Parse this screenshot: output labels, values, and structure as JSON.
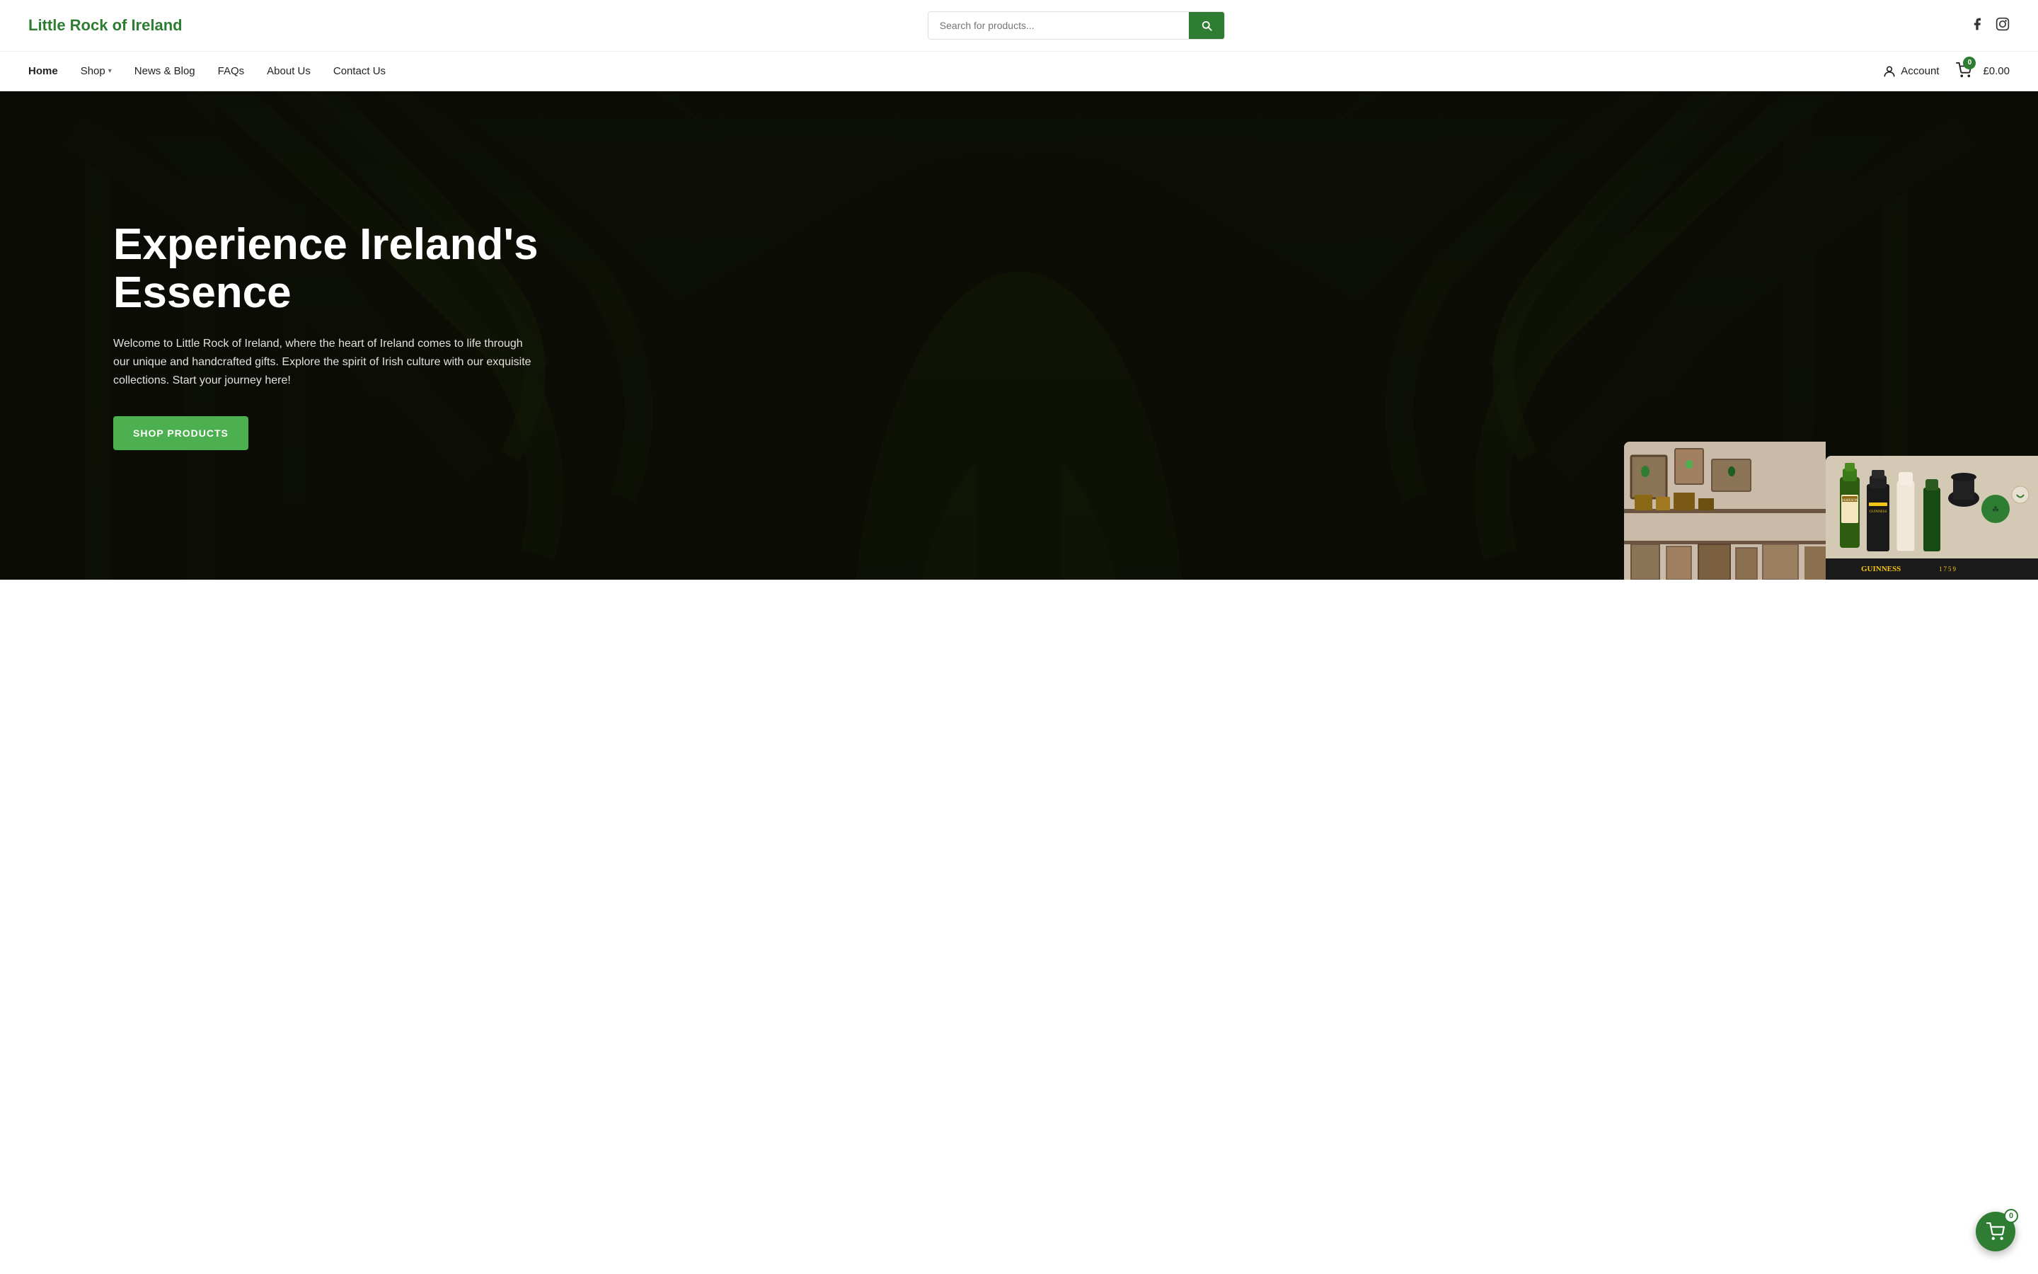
{
  "header": {
    "logo": "Little Rock of Ireland",
    "search_placeholder": "Search for products...",
    "search_button_label": "Search",
    "social": {
      "facebook_label": "Facebook",
      "instagram_label": "Instagram"
    }
  },
  "nav": {
    "items": [
      {
        "label": "Home",
        "active": true,
        "has_dropdown": false
      },
      {
        "label": "Shop",
        "active": false,
        "has_dropdown": true
      },
      {
        "label": "News & Blog",
        "active": false,
        "has_dropdown": false
      },
      {
        "label": "FAQs",
        "active": false,
        "has_dropdown": false
      },
      {
        "label": "About Us",
        "active": false,
        "has_dropdown": false
      },
      {
        "label": "Contact Us",
        "active": false,
        "has_dropdown": false
      }
    ],
    "account_label": "Account",
    "cart_count": "0",
    "cart_price": "£0.00"
  },
  "hero": {
    "title": "Experience Ireland's Essence",
    "description": "Welcome to Little Rock of Ireland, where the heart of Ireland comes to life through our unique and handcrafted gifts. Explore the spirit of Irish culture with our exquisite collections. Start your journey here!",
    "cta_label": "SHOP PRODUCTS"
  },
  "floating_cart": {
    "count": "0"
  },
  "colors": {
    "green": "#2e7d32",
    "green_light": "#4caf50"
  }
}
